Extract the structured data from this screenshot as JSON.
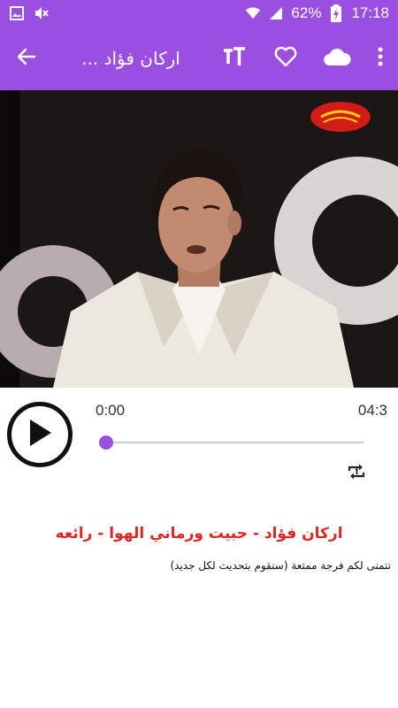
{
  "status_bar": {
    "battery": "62%",
    "time": "17:18",
    "icons": [
      "image-icon",
      "mute-icon",
      "wifi-icon",
      "signal-icon",
      "battery-charging-icon"
    ]
  },
  "app_bar": {
    "title": "اركان فؤاد ...",
    "actions": [
      "back-arrow-icon",
      "text-size-icon",
      "heart-icon",
      "cloud-icon",
      "more-vert-icon"
    ]
  },
  "player": {
    "current_time": "0:00",
    "duration": "04:3",
    "progress": 0.0
  },
  "song": {
    "title": "اركان فؤاد - حبيت ورماني الهوا - رائعه",
    "subtitle": "نتمنى لكم فرجة ممتعة (سنقوم بتحديث لكل جديد)"
  },
  "colors": {
    "accent": "#9b4fe0",
    "title_red": "#e0241f"
  }
}
